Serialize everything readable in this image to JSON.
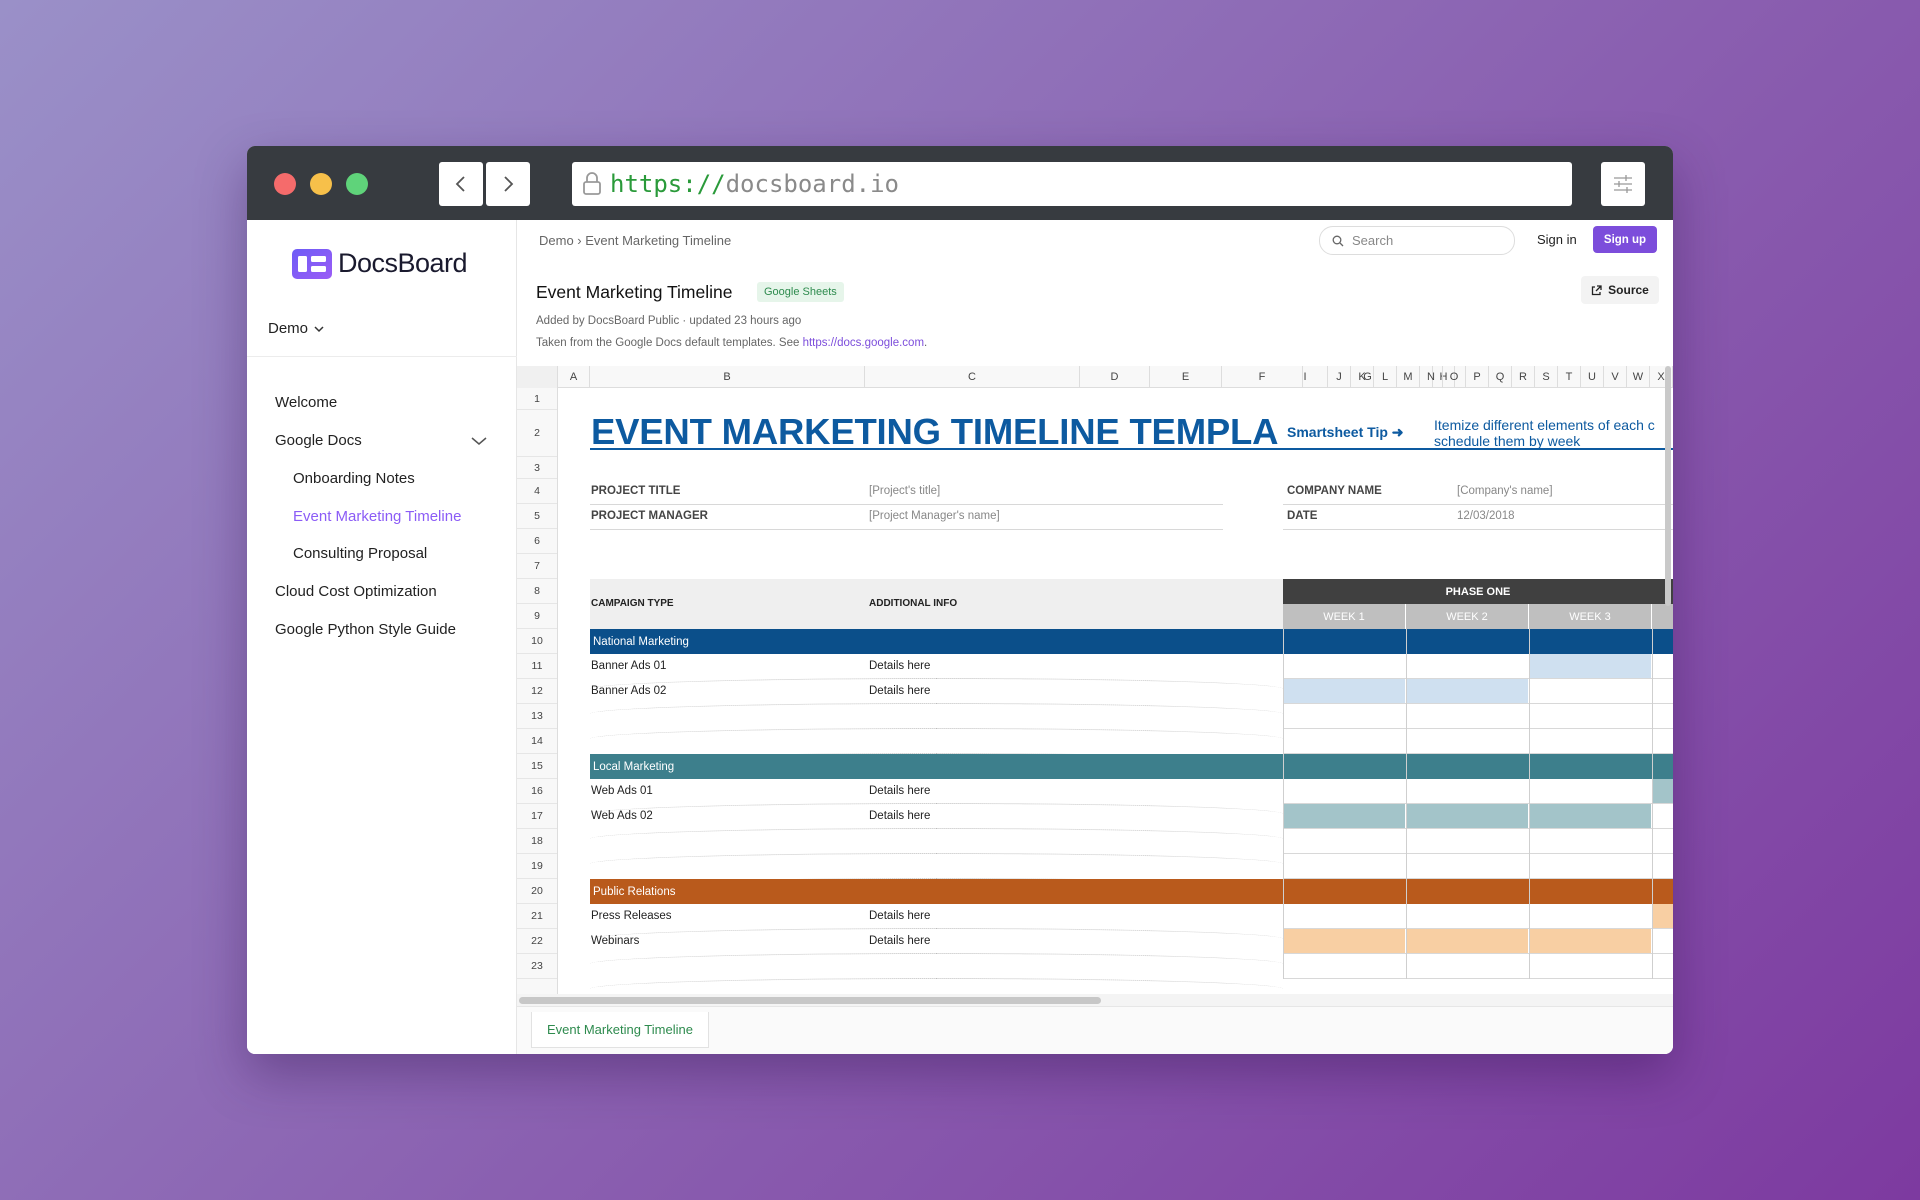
{
  "browser": {
    "url_protocol": "https://",
    "url_host": "docsboard.io"
  },
  "sidebar": {
    "logo_text": "DocsBoard",
    "workspace": "Demo",
    "items": [
      {
        "label": "Welcome"
      },
      {
        "label": "Google Docs"
      },
      {
        "label": "Onboarding Notes"
      },
      {
        "label": "Event Marketing Timeline"
      },
      {
        "label": "Consulting Proposal"
      },
      {
        "label": "Cloud Cost Optimization"
      },
      {
        "label": "Google Python Style Guide"
      }
    ],
    "active_item": "Event Marketing Timeline",
    "accent_color": "#8b5cf6"
  },
  "header": {
    "breadcrumb": "Demo › Event Marketing Timeline",
    "search_placeholder": "Search",
    "signin": "Sign in",
    "signup": "Sign up"
  },
  "doc": {
    "title": "Event Marketing Timeline",
    "tag": "Google Sheets",
    "source_label": "Source",
    "meta": "Added by DocsBoard Public · updated 23 hours ago",
    "note_prefix": "Taken from the Google Docs default templates. See ",
    "note_link": "https://docs.google.com",
    "note_suffix": "."
  },
  "sheet": {
    "columns": [
      "A",
      "B",
      "C",
      "D",
      "E",
      "F",
      "G",
      "H",
      "I",
      "J",
      "K",
      "L",
      "M",
      "N",
      "O",
      "P",
      "Q",
      "R",
      "S",
      "T",
      "U",
      "V",
      "W",
      "X"
    ],
    "rows": [
      "1",
      "2",
      "3",
      "4",
      "5",
      "6",
      "7",
      "8",
      "9",
      "10",
      "11",
      "12",
      "13",
      "14",
      "15",
      "16",
      "17",
      "18",
      "19",
      "20",
      "21",
      "22",
      "23"
    ],
    "title": "EVENT MARKETING TIMELINE TEMPLA",
    "tip_label": "Smartsheet Tip ➜",
    "tip_line1": "Itemize different elements of each c",
    "tip_line2": "schedule them by week",
    "project_title_label": "PROJECT TITLE",
    "project_title_value": "[Project's title]",
    "project_manager_label": "PROJECT MANAGER",
    "project_manager_value": "[Project Manager's name]",
    "company_label": "COMPANY NAME",
    "company_value": "[Company's name]",
    "date_label": "DATE",
    "date_value": "12/03/2018",
    "campaign_type_header": "CAMPAIGN TYPE",
    "additional_info_header": "ADDITIONAL INFO",
    "phase": "PHASE ONE",
    "weeks": [
      "WEEK 1",
      "WEEK 2",
      "WEEK 3"
    ],
    "sections": [
      {
        "name": "National Marketing",
        "color": "#0b4f8a",
        "fill": "#cfe0f0",
        "rows": [
          {
            "name": "Banner Ads 01",
            "info": "Details here"
          },
          {
            "name": "Banner Ads 02",
            "info": "Details here"
          }
        ]
      },
      {
        "name": "Local Marketing",
        "color": "#3d7f8c",
        "fill": "#a3c4c9",
        "rows": [
          {
            "name": "Web Ads 01",
            "info": "Details here"
          },
          {
            "name": "Web Ads 02",
            "info": "Details here"
          }
        ]
      },
      {
        "name": "Public Relations",
        "color": "#b95a1c",
        "fill": "#f8cfa3",
        "rows": [
          {
            "name": "Press Releases",
            "info": "Details here"
          },
          {
            "name": "Webinars",
            "info": "Details here"
          }
        ]
      }
    ],
    "tab_name": "Event Marketing Timeline"
  }
}
